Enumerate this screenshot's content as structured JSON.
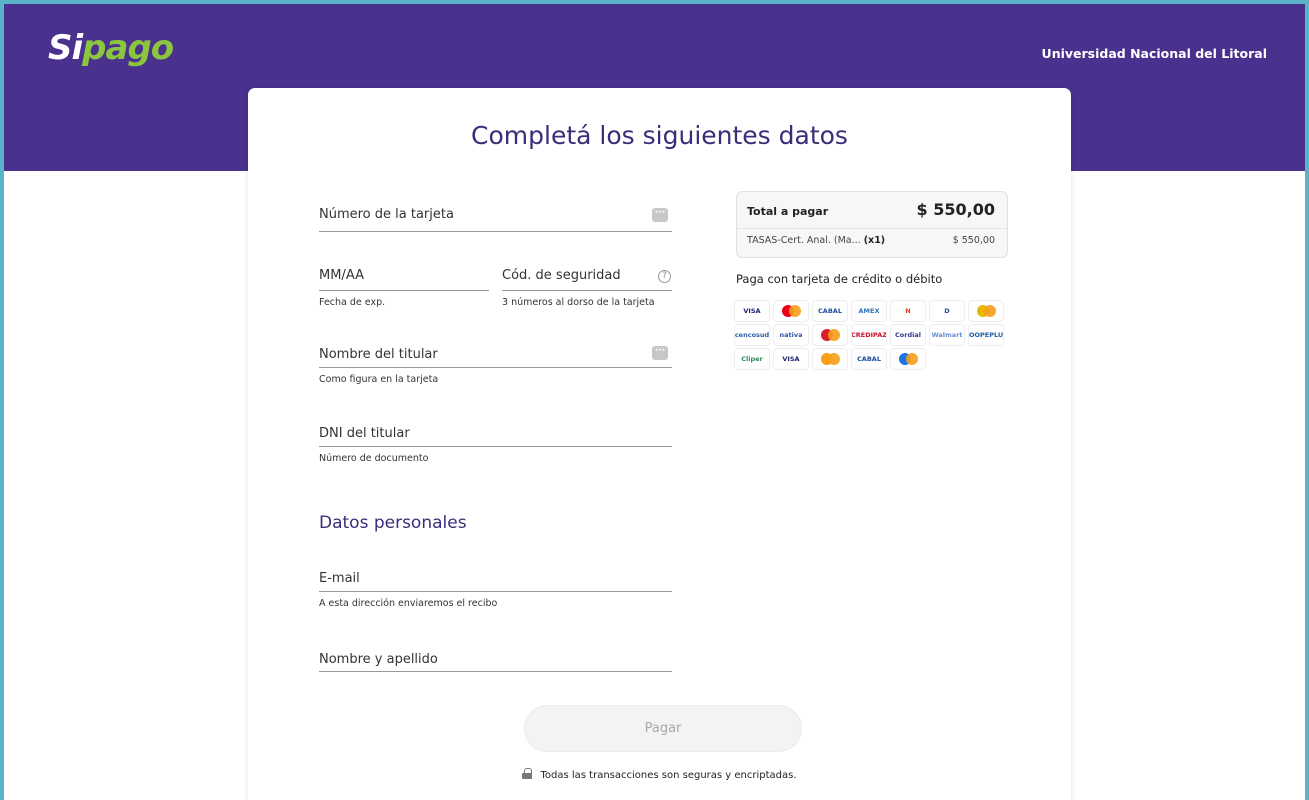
{
  "header": {
    "logo_si": "Si",
    "logo_pago": "pago",
    "organization": "Universidad Nacional del Litoral"
  },
  "form": {
    "title": "Completá los siguientes datos",
    "card_number": {
      "label": "Número de la tarjeta"
    },
    "expiry": {
      "label": "MM/AA",
      "hint": "Fecha de exp."
    },
    "cvv": {
      "label": "Cód. de seguridad",
      "hint": "3 números al dorso de la tarjeta"
    },
    "holder_name": {
      "label": "Nombre del titular",
      "hint": "Como figura en la tarjeta"
    },
    "holder_dni": {
      "label": "DNI del titular",
      "hint": "Número de documento"
    },
    "personal_section": "Datos personales",
    "email": {
      "label": "E-mail",
      "hint": "A esta dirección enviaremos el recibo"
    },
    "full_name": {
      "label": "Nombre y apellido"
    },
    "pay_button": "Pagar",
    "secure_note": "Todas las transacciones son seguras y encriptadas."
  },
  "summary": {
    "total_label": "Total a pagar",
    "total_amount": "$ 550,00",
    "item_name": "TASAS-Cert. Anal. (Ma...",
    "item_qty": "(x1)",
    "item_amount": "$ 550,00"
  },
  "payment_methods": {
    "title": "Paga con tarjeta de crédito o débito",
    "brands": [
      {
        "name": "visa",
        "text": "VISA",
        "color": "#1a1f71"
      },
      {
        "name": "mastercard",
        "text": "",
        "color": "#eb001b"
      },
      {
        "name": "cabal",
        "text": "CABAL",
        "color": "#1c4b9c"
      },
      {
        "name": "amex",
        "text": "AMEX",
        "color": "#2e77bb"
      },
      {
        "name": "naranja",
        "text": "N",
        "color": "#e8391d"
      },
      {
        "name": "diners",
        "text": "D",
        "color": "#1b4f9c"
      },
      {
        "name": "argencard",
        "text": "",
        "color": "#e6b800"
      },
      {
        "name": "cencosud",
        "text": "cencosud",
        "color": "#2e5ea8"
      },
      {
        "name": "nativa",
        "text": "nativa",
        "color": "#2c57a6"
      },
      {
        "name": "argenta",
        "text": "",
        "color": "#d81e2c"
      },
      {
        "name": "credipaz",
        "text": "CREDIPAZ",
        "color": "#c8102e"
      },
      {
        "name": "cordial",
        "text": "Cordial",
        "color": "#2b3990"
      },
      {
        "name": "walmart",
        "text": "Walmart",
        "color": "#6c8fd0"
      },
      {
        "name": "coopeplus",
        "text": "COOPEPLUS",
        "color": "#1f5aa6"
      },
      {
        "name": "cliper",
        "text": "Cliper",
        "color": "#2e8b57"
      },
      {
        "name": "visa-debito",
        "text": "VISA",
        "color": "#1a1f71"
      },
      {
        "name": "maestro",
        "text": "",
        "color": "#f79e1b"
      },
      {
        "name": "cabal-debito",
        "text": "CABAL",
        "color": "#1c4b9c"
      },
      {
        "name": "maestro-2",
        "text": "",
        "color": "#1a73e8"
      }
    ]
  }
}
